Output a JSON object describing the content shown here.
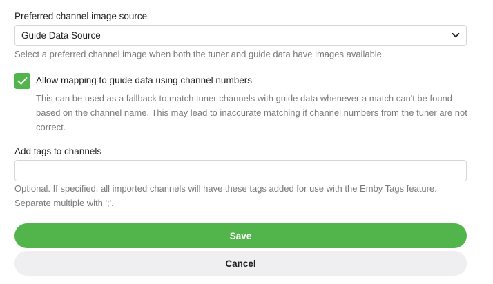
{
  "image_source": {
    "label": "Preferred channel image source",
    "selected": "Guide Data Source",
    "help": "Select a preferred channel image when both the tuner and guide data have images available."
  },
  "channel_mapping": {
    "checked": true,
    "label": "Allow mapping to guide data using channel numbers",
    "description": "This can be used as a fallback to match tuner channels with guide data whenever a match can't be found based on the channel name. This may lead to inaccurate matching if channel numbers from the tuner are not correct."
  },
  "tags": {
    "label": "Add tags to channels",
    "value": "",
    "help": "Optional. If specified, all imported channels will have these tags added for use with the Emby Tags feature. Separate multiple with ';'."
  },
  "actions": {
    "save_label": "Save",
    "cancel_label": "Cancel"
  },
  "colors": {
    "accent": "#52b54b",
    "cancel_bg": "#efeff1",
    "help_text": "#7a7a7a"
  }
}
